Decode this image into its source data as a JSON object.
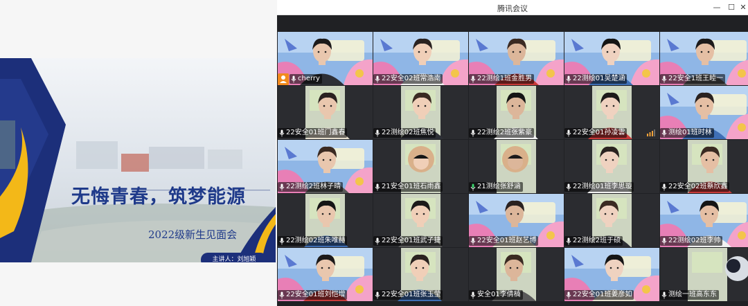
{
  "slide": {
    "title": "无悔青春，筑梦能源",
    "subtitle": "2022级新生见面会",
    "speaker": "主讲人：刘旭颖",
    "colors": {
      "navy": "#1c2f7a",
      "gold": "#f3b818",
      "title": "#1f3a8a"
    }
  },
  "meeting_window": {
    "title": "腾讯会议",
    "controls": {
      "minimize": "—",
      "maximize": "☐",
      "close": "✕"
    }
  },
  "participants": [
    {
      "name": "cherry",
      "bg": "banner",
      "host": true
    },
    {
      "name": "22安全02班常浩南",
      "bg": "banner"
    },
    {
      "name": "22测绘1班金胜男",
      "bg": "banner"
    },
    {
      "name": "22测绘01吴楚涵",
      "bg": "banner"
    },
    {
      "name": "22安全1班王睦一",
      "bg": "banner"
    },
    {
      "name": "22安全01班门鑫春",
      "bg": "dark"
    },
    {
      "name": "22测绘02班焦悦",
      "bg": "dark"
    },
    {
      "name": "22测绘2班张紫豪",
      "bg": "dark"
    },
    {
      "name": "22安全01孙凌雲",
      "bg": "dark",
      "signal": true
    },
    {
      "name": "测绘01班时林",
      "bg": "banner"
    },
    {
      "name": "22测绘2班林子晴",
      "bg": "banner"
    },
    {
      "name": "21安全01班石雨鑫",
      "bg": "dark"
    },
    {
      "name": "21测绘张舒涵",
      "bg": "dark",
      "active": true
    },
    {
      "name": "22测绘01班李思璇",
      "bg": "dark"
    },
    {
      "name": "22安全02班蔡欣鑫",
      "bg": "dark"
    },
    {
      "name": "22测绘02班朱唯赫",
      "bg": "dark"
    },
    {
      "name": "22安全01班武子捷",
      "bg": "dark"
    },
    {
      "name": "22安全01班赵艺博",
      "bg": "banner",
      "muted_icon": false
    },
    {
      "name": "22测绘2班于硕",
      "bg": "dark",
      "muted_icon": false
    },
    {
      "name": "22测绘02班李帅",
      "bg": "banner"
    },
    {
      "name": "22安全01班刘恺增",
      "bg": "banner"
    },
    {
      "name": "22安全01班张玉莹",
      "bg": "dark"
    },
    {
      "name": "安全01李倩楠",
      "bg": "dark"
    },
    {
      "name": "22安全01班姜彦如",
      "bg": "banner"
    },
    {
      "name": "测绘一班高东东",
      "bg": "dark"
    }
  ],
  "colors": {
    "active_border": "#21b35a",
    "host_badge": "#f28a1c",
    "tile_bg": "#26272b",
    "window_bg": "#202124"
  }
}
